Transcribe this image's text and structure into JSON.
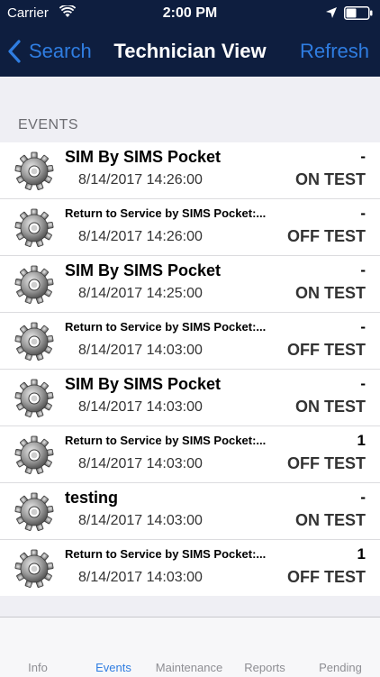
{
  "status_bar": {
    "carrier": "Carrier",
    "time": "2:00 PM"
  },
  "nav": {
    "back_label": "Search",
    "title": "Technician View",
    "refresh_label": "Refresh"
  },
  "section_header": "EVENTS",
  "events": [
    {
      "title": "SIM By SIMS Pocket",
      "date": "8/14/2017 14:26:00",
      "value": "-",
      "status": "ON TEST"
    },
    {
      "title": "Return to Service by SIMS Pocket:...",
      "date": "8/14/2017 14:26:00",
      "value": "-",
      "status": "OFF TEST"
    },
    {
      "title": "SIM By SIMS Pocket",
      "date": "8/14/2017 14:25:00",
      "value": "-",
      "status": "ON TEST"
    },
    {
      "title": "Return to Service by SIMS Pocket:...",
      "date": "8/14/2017 14:03:00",
      "value": "-",
      "status": "OFF TEST"
    },
    {
      "title": "SIM By SIMS Pocket",
      "date": "8/14/2017 14:03:00",
      "value": "-",
      "status": "ON TEST"
    },
    {
      "title": "Return to Service by SIMS Pocket:...",
      "date": "8/14/2017 14:03:00",
      "value": "1",
      "status": "OFF TEST"
    },
    {
      "title": "testing",
      "date": "8/14/2017 14:03:00",
      "value": "-",
      "status": "ON TEST"
    },
    {
      "title": "Return to Service by SIMS Pocket:...",
      "date": "8/14/2017 14:03:00",
      "value": "1",
      "status": "OFF TEST"
    }
  ],
  "tabs": [
    {
      "label": "Info"
    },
    {
      "label": "Events"
    },
    {
      "label": "Maintenance"
    },
    {
      "label": "Reports"
    },
    {
      "label": "Pending"
    }
  ],
  "colors": {
    "nav_background": "#0e1e3f",
    "accent": "#2f7de1",
    "background": "#efeff4"
  }
}
